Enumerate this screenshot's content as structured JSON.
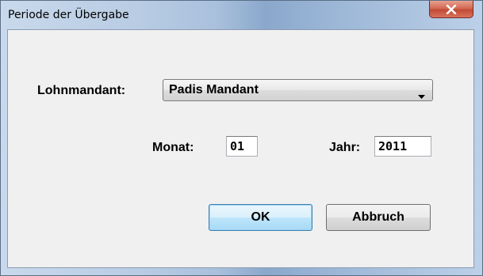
{
  "window": {
    "title": "Periode der Übergabe",
    "close_icon": "close-icon"
  },
  "form": {
    "mandant_label": "Lohnmandant:",
    "mandant_value": "Padis Mandant",
    "month_label": "Monat:",
    "month_value": "01",
    "year_label": "Jahr:",
    "year_value": "2011"
  },
  "buttons": {
    "ok_label": "OK",
    "cancel_label": "Abbruch"
  },
  "colors": {
    "close_button": "#c24a35",
    "default_button_border": "#3c7fb1",
    "dialog_background": "#f0f0f0"
  }
}
